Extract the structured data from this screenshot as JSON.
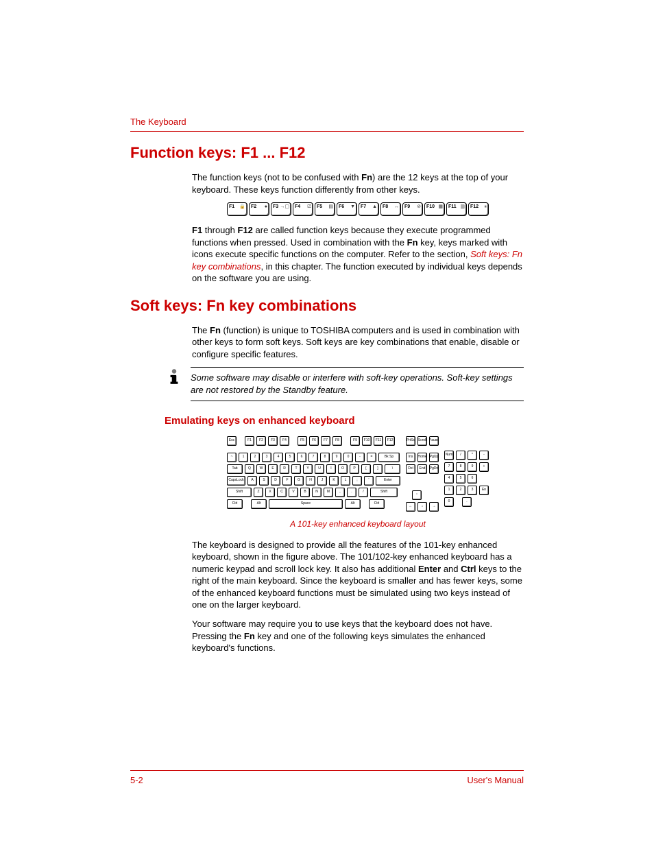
{
  "header": {
    "label": "The Keyboard"
  },
  "sections": {
    "function_keys": {
      "title": "Function keys: F1 ... F12",
      "p1_a": "The function keys (not to be confused with ",
      "p1_fn": "Fn",
      "p1_b": ") are the 12 keys at the top of your keyboard. These keys function differently from other keys.",
      "fkeys": [
        "F1",
        "F2",
        "F3",
        "F4",
        "F5",
        "F6",
        "F7",
        "F8",
        "F9",
        "F10",
        "F11",
        "F12"
      ],
      "p2_a": "F1",
      "p2_b": " through ",
      "p2_c": "F12",
      "p2_d": " are called function keys because they execute programmed functions when pressed. Used in combination with the ",
      "p2_e": "Fn",
      "p2_f": " key, keys marked with icons execute specific functions on the computer. Refer to the section, ",
      "p2_link": "Soft keys: Fn key combinations",
      "p2_g": ", in this chapter. The function executed by individual keys depends on the software you are using."
    },
    "soft_keys": {
      "title": "Soft keys: Fn key combinations",
      "p1_a": "The ",
      "p1_b": "Fn",
      "p1_c": " (function) is unique to TOSHIBA computers and is used in combination with other keys to form soft keys. Soft keys are key combinations that enable, disable or configure specific features.",
      "note": "Some software may disable or interfere with soft-key operations. Soft-key settings are not restored by the Standby feature.",
      "sub_title": "Emulating keys on enhanced keyboard",
      "caption": "A 101-key enhanced keyboard layout",
      "p2_a": "The keyboard is designed to provide all the features of the 101-key enhanced keyboard, shown in the figure above. The 101/102-key enhanced keyboard has a numeric keypad and scroll lock key. It also has additional ",
      "p2_b": "Enter",
      "p2_c": " and ",
      "p2_d": "Ctrl",
      "p2_e": " keys to the right of the main keyboard. Since the keyboard is smaller and has fewer keys, some of the enhanced keyboard functions must be simulated using two keys instead of one on the larger keyboard.",
      "p3_a": "Your software may require you to use keys that the keyboard does not have. Pressing the ",
      "p3_b": "Fn",
      "p3_c": " key and one of the following keys simulates the enhanced keyboard's functions."
    }
  },
  "keyboard_layout": {
    "main": [
      [
        "Esc",
        "",
        "F1",
        "F2",
        "F3",
        "F4",
        "",
        "F5",
        "F6",
        "F7",
        "F8",
        "",
        "F9",
        "F10",
        "F11",
        "F12"
      ],
      [
        "~",
        "1",
        "2",
        "3",
        "4",
        "5",
        "6",
        "7",
        "8",
        "9",
        "0",
        "-",
        "=",
        "Bk Sp"
      ],
      [
        "Tab",
        "Q",
        "W",
        "E",
        "R",
        "T",
        "Y",
        "U",
        "I",
        "O",
        "P",
        "[",
        "]",
        "\\"
      ],
      [
        "CapsLock",
        "A",
        "S",
        "D",
        "F",
        "G",
        "H",
        "J",
        "K",
        "L",
        ";",
        "'",
        "Enter"
      ],
      [
        "Shift",
        "Z",
        "X",
        "C",
        "V",
        "B",
        "N",
        "M",
        ",",
        ".",
        "/",
        "Shift"
      ],
      [
        "Ctrl",
        "",
        "Alt",
        "Space",
        "Alt",
        "",
        "Ctrl"
      ]
    ],
    "nav": [
      [
        "PrtSc",
        "Scroll",
        "Pause"
      ],
      [
        "Ins",
        "Home",
        "PgUp"
      ],
      [
        "Del",
        "End",
        "PgDn"
      ],
      [
        "",
        "↑",
        ""
      ],
      [
        "←",
        "↓",
        "→"
      ]
    ],
    "numpad": [
      [
        "Num",
        "/",
        "*",
        "-"
      ],
      [
        "7",
        "8",
        "9",
        "+"
      ],
      [
        "4",
        "5",
        "6",
        ""
      ],
      [
        "1",
        "2",
        "3",
        "En"
      ],
      [
        "0",
        "",
        ".",
        ""
      ]
    ]
  },
  "footer": {
    "page": "5-2",
    "manual": "User's Manual"
  }
}
